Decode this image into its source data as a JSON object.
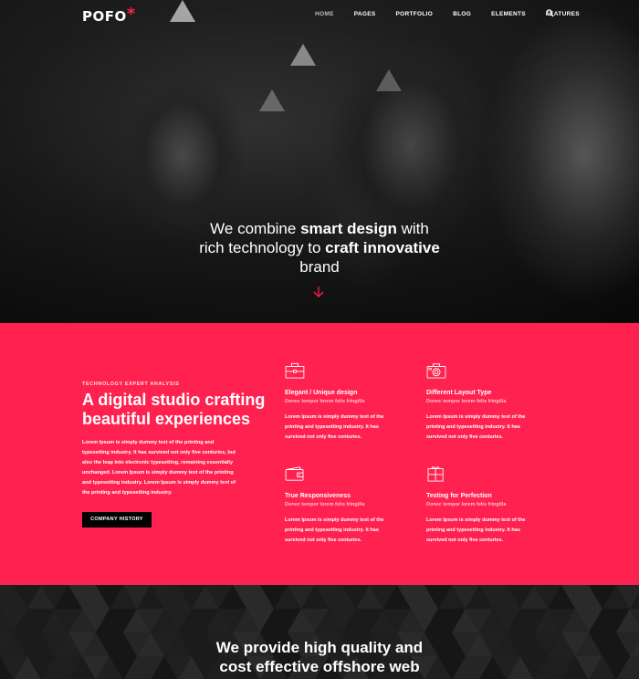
{
  "nav": {
    "logo": "POFO",
    "logo_mark": "*",
    "items": [
      "HOME",
      "PAGES",
      "PORTFOLIO",
      "BLOG",
      "ELEMENTS",
      "FEATURES"
    ],
    "active": "HOME",
    "search_icon": "search-icon"
  },
  "hero": {
    "line1_pre": "We combine ",
    "line1_bold": "smart design",
    "line1_post": " with",
    "line2_pre": "rich technology to ",
    "line2_bold": "craft innovative",
    "line3": "brand",
    "scroll_icon": "arrow-down-icon"
  },
  "intro": {
    "eyebrow": "TECHNOLOGY EXPERT ANALYSIS",
    "heading_light": "A digital studio crafting",
    "heading_bold": "beautiful experiences",
    "paragraph": "Lorem Ipsum is simply dummy text of the printing and typesetting industry. It has survived not only five centuries, but also the leap into electronic typesetting, remaining essentially unchanged. Lorem Ipsum is simply dummy text of the printing and typesetting industry. Lorem Ipsum is simply dummy text of the printing and typesetting industry.",
    "button": "COMPANY HISTORY"
  },
  "features": [
    {
      "icon": "briefcase-icon",
      "title": "Elegant / Unique design",
      "subtitle": "Donec tempor lorem felis fringilla",
      "text": "Lorem Ipsum is simply dummy text of the printing and typesetting industry. It has survived not only five centuries."
    },
    {
      "icon": "camera-icon",
      "title": "Different Layout Type",
      "subtitle": "Donec tempor lorem felis fringilla",
      "text": "Lorem Ipsum is simply dummy text of the printing and typesetting industry. It has survived not only five centuries."
    },
    {
      "icon": "wallet-icon",
      "title": "True Responsiveness",
      "subtitle": "Donec tempor lorem felis fringilla",
      "text": "Lorem Ipsum is simply dummy text of the printing and typesetting industry. It has survived not only five centuries."
    },
    {
      "icon": "gift-icon",
      "title": "Testing for Perfection",
      "subtitle": "Donec tempor lorem felis fringilla",
      "text": "Lorem Ipsum is simply dummy text of the printing and typesetting industry. It has survived not only five centuries."
    }
  ],
  "provide": {
    "line1_pre": "We provide ",
    "line1_bold": "high quality",
    "line1_post": " and",
    "line2_pre": "cost effective ",
    "line2_bold": "offshore",
    "line2_post": " web"
  },
  "colors": {
    "accent": "#ff214f",
    "dark": "#141414",
    "button": "#000000"
  }
}
